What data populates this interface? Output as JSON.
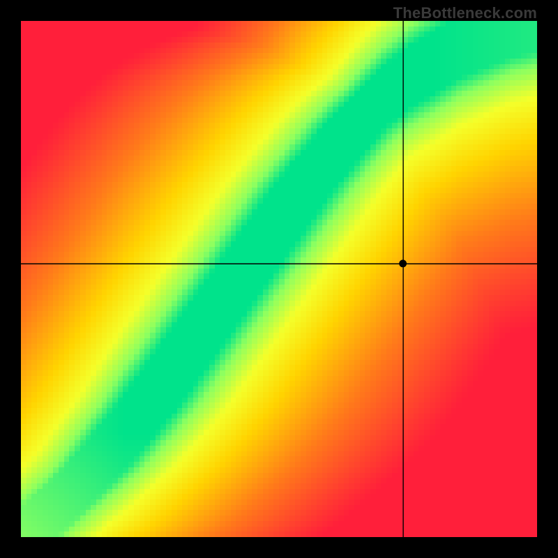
{
  "watermark": "TheBottleneck.com",
  "chart_data": {
    "type": "heatmap",
    "title": "",
    "xlabel": "",
    "ylabel": "",
    "xlim": [
      0,
      100
    ],
    "ylim": [
      0,
      100
    ],
    "color_scale": {
      "stops": [
        {
          "t": 0.0,
          "hex": "#ff1f3a"
        },
        {
          "t": 0.35,
          "hex": "#ff7a1a"
        },
        {
          "t": 0.63,
          "hex": "#ffd400"
        },
        {
          "t": 0.8,
          "hex": "#f4ff2a"
        },
        {
          "t": 0.92,
          "hex": "#8cff60"
        },
        {
          "t": 1.0,
          "hex": "#00e38b"
        }
      ]
    },
    "optimal_curve": {
      "description": "diagonal ridge of maximum score; y as a function of x (0..100)",
      "x": [
        0,
        5,
        10,
        15,
        20,
        25,
        30,
        35,
        40,
        45,
        50,
        55,
        60,
        65,
        70,
        75,
        80,
        85,
        90,
        95,
        100
      ],
      "y": [
        0,
        4,
        9,
        14,
        20,
        26,
        33,
        40,
        47,
        54,
        61,
        68,
        74,
        80,
        85,
        89,
        92,
        95,
        97,
        99,
        100
      ],
      "ridge_half_width": 6
    },
    "marker": {
      "x": 74,
      "y": 53
    },
    "pixelation": 96
  }
}
